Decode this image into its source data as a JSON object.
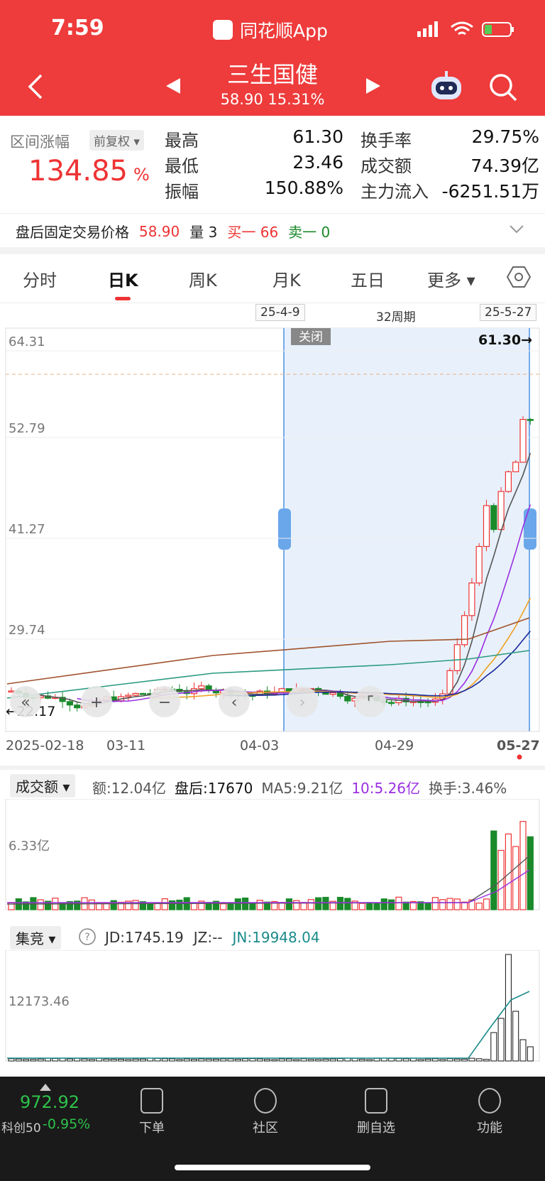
{
  "status": {
    "time": "7:59",
    "app_name": "同花顺App"
  },
  "header": {
    "title": "三生国健",
    "subtitle": "58.90 15.31%"
  },
  "range": {
    "label": "区间涨幅",
    "adj": "前复权",
    "pct": "134.85",
    "pct_unit": "%"
  },
  "stats": [
    {
      "label": "最高",
      "value": "61.30"
    },
    {
      "label": "最低",
      "value": "23.46"
    },
    {
      "label": "振幅",
      "value": "150.88%"
    },
    {
      "label": "换手率",
      "value": "29.75%"
    },
    {
      "label": "成交额",
      "value": "74.39亿"
    },
    {
      "label": "主力流入",
      "value": "-6251.51万"
    }
  ],
  "after_hours": {
    "label": "盘后固定交易价格",
    "price": "58.90",
    "qty": "量 3",
    "buy": "买一 66",
    "sell": "卖一 0"
  },
  "tabs": [
    "分时",
    "日K",
    "周K",
    "月K",
    "五日",
    "更多"
  ],
  "active_tab": "日K",
  "range_bar": {
    "start": "25-4-9",
    "period": "32周期",
    "end": "25-5-27",
    "close": "关闭"
  },
  "chart": {
    "y_ticks": [
      "64.31",
      "52.79",
      "41.27",
      "29.74"
    ],
    "max_label": "61.30→",
    "min_label": "←22.17",
    "x_ticks": [
      "2025-02-18",
      "03-11",
      "04-03",
      "04-29",
      "05-27"
    ]
  },
  "volume": {
    "selector": "成交额",
    "amount": "额:12.04亿",
    "after": "盘后:17670",
    "ma5": "MA5:9.21亿",
    "ma10": "10:5.26亿",
    "turnover": "换手:3.46%",
    "y_tick": "6.33亿"
  },
  "auction": {
    "selector": "集竞",
    "jd": "JD:1745.19",
    "jz": "JZ:--",
    "jn": "JN:19948.04",
    "y_tick": "12173.46"
  },
  "bottom": {
    "index_value": "972.92",
    "index_name": "科创50",
    "index_change": "-0.95%",
    "items": [
      "下单",
      "社区",
      "删自选",
      "功能"
    ]
  },
  "colors": {
    "up": "#e33",
    "down": "#1a8a2a",
    "header": "#ee3b3b",
    "ma5": "#555",
    "ma10": "#9a2fe0",
    "ma20": "#f0a020",
    "ma30": "#1a2a9a",
    "ma60": "#a0522d",
    "ma120": "#2a9a80"
  }
}
